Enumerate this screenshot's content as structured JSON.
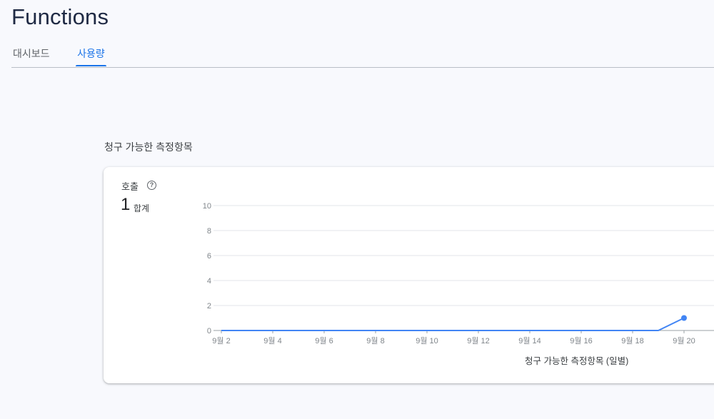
{
  "page": {
    "title": "Functions"
  },
  "tabs": [
    {
      "label": "대시보드",
      "active": false
    },
    {
      "label": "사용량",
      "active": true
    }
  ],
  "section": {
    "title": "청구 가능한 측정항목"
  },
  "metric": {
    "name": "호출",
    "value": "1",
    "unit": "합계",
    "help_icon": "help-circle-icon"
  },
  "colors": {
    "accent": "#1a73e8",
    "series": "#4285f4"
  },
  "chart_data": {
    "type": "line",
    "title": "",
    "xlabel": "청구 가능한 측정항목 (일별)",
    "ylabel": "",
    "ylim": [
      0,
      10
    ],
    "yticks": [
      0,
      2,
      4,
      6,
      8,
      10
    ],
    "xticks": [
      "9월 2",
      "9월 4",
      "9월 6",
      "9월 8",
      "9월 10",
      "9월 12",
      "9월 14",
      "9월 16",
      "9월 18",
      "9월 20"
    ],
    "series": [
      {
        "values": [
          {
            "x": "9월 2",
            "y": 0
          },
          {
            "x": "9월 18",
            "y": 0
          },
          {
            "x": "9월 19",
            "y": 0
          },
          {
            "x": "9월 20",
            "y": 1
          }
        ]
      }
    ],
    "grid": true
  }
}
